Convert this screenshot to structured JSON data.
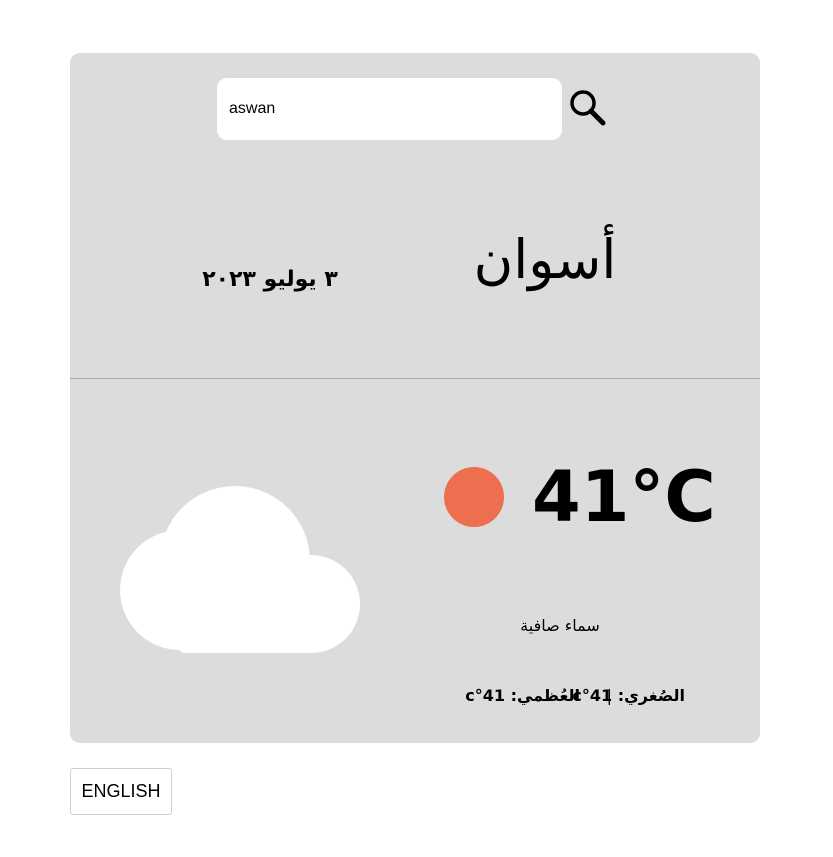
{
  "search": {
    "value": "aswan",
    "button_icon": "search-icon"
  },
  "location": {
    "city": "أسوان",
    "date": "٣ يوليو ٢٠٢٣"
  },
  "weather": {
    "temperature": "41°C",
    "indicator_color": "#ee6f4f",
    "icon": "cloud-icon",
    "description": "سماء صافية",
    "min": "الصُغري: 41°c",
    "separator": "|",
    "max": "العُظمي: 41°c"
  },
  "language_button": {
    "label": "ENGLISH"
  },
  "colors": {
    "card_background": "#dcdcdc",
    "page_background": "#ffffff"
  }
}
